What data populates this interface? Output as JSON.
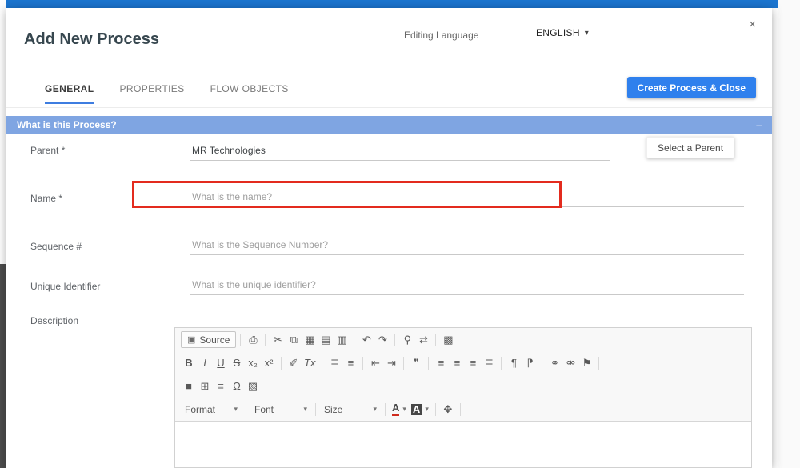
{
  "colors": {
    "accent_blue": "#2f80ed",
    "app_bar_blue": "#1b75d0",
    "section_bar_blue": "#7fa5e2",
    "highlight_red": "#e32b1e"
  },
  "icons": {
    "caret": "▾"
  },
  "modal": {
    "title": "Add New Process",
    "editing_language_label": "Editing Language",
    "language_value": "ENGLISH",
    "close_icon": "×",
    "tabs": [
      {
        "label": "GENERAL"
      },
      {
        "label": "PROPERTIES"
      },
      {
        "label": "FLOW OBJECTS"
      }
    ],
    "create_button_label": "Create Process & Close",
    "section": {
      "title": "What is this Process?",
      "collapse_icon": "–"
    },
    "fields": {
      "parent": {
        "label": "Parent *",
        "value": "MR Technologies",
        "button_label": "Select a Parent"
      },
      "name": {
        "label": "Name *",
        "placeholder": "What is the name?"
      },
      "sequence": {
        "label": "Sequence #",
        "placeholder": "What is the Sequence Number?"
      },
      "unique": {
        "label": "Unique Identifier",
        "placeholder": "What is the unique identifier?"
      },
      "description": {
        "label": "Description"
      }
    },
    "editor": {
      "toolbar1": [
        {
          "name": "source-button",
          "icon": "▣",
          "label": "Source"
        },
        {
          "sep": true
        },
        {
          "name": "print-icon",
          "glyph": "⎙"
        },
        {
          "sep": true
        },
        {
          "name": "cut-icon",
          "glyph": "✂"
        },
        {
          "name": "copy-icon",
          "glyph": "⧉"
        },
        {
          "name": "paste-icon",
          "glyph": "▦"
        },
        {
          "name": "paste-text-icon",
          "glyph": "▤"
        },
        {
          "name": "paste-word-icon",
          "glyph": "▥"
        },
        {
          "sep": true
        },
        {
          "name": "undo-icon",
          "glyph": "↶"
        },
        {
          "name": "redo-icon",
          "glyph": "↷"
        },
        {
          "sep": true
        },
        {
          "name": "find-icon",
          "glyph": "⚲"
        },
        {
          "name": "replace-icon",
          "glyph": "⇄"
        },
        {
          "sep": true
        },
        {
          "name": "select-all-icon",
          "glyph": "▩"
        }
      ],
      "toolbar2": [
        {
          "name": "bold-icon",
          "glyph": "B",
          "cls": "g-bold"
        },
        {
          "name": "italic-icon",
          "glyph": "I",
          "cls": "g-italic"
        },
        {
          "name": "underline-icon",
          "glyph": "U",
          "cls": "g-under"
        },
        {
          "name": "strike-icon",
          "glyph": "S",
          "cls": "g-strike"
        },
        {
          "name": "subscript-icon",
          "glyph": "x₂"
        },
        {
          "name": "superscript-icon",
          "glyph": "x²"
        },
        {
          "sep": true
        },
        {
          "name": "copy-formatting-icon",
          "glyph": "✐"
        },
        {
          "name": "remove-format-icon",
          "glyph": "Tx",
          "cls": "g-italic"
        },
        {
          "sep": true
        },
        {
          "name": "numbered-list-icon",
          "glyph": "≣"
        },
        {
          "name": "bulleted-list-icon",
          "glyph": "≡"
        },
        {
          "sep": true
        },
        {
          "name": "outdent-icon",
          "glyph": "⇤"
        },
        {
          "name": "indent-icon",
          "glyph": "⇥"
        },
        {
          "sep": true
        },
        {
          "name": "blockquote-icon",
          "glyph": "❞"
        },
        {
          "sep": true
        },
        {
          "name": "align-left-icon",
          "glyph": "≡"
        },
        {
          "name": "align-center-icon",
          "glyph": "≡"
        },
        {
          "name": "align-right-icon",
          "glyph": "≡"
        },
        {
          "name": "align-justify-icon",
          "glyph": "≣"
        },
        {
          "sep": true
        },
        {
          "name": "text-direction-ltr-icon",
          "glyph": "¶"
        },
        {
          "name": "text-direction-rtl-icon",
          "glyph": "⁋"
        },
        {
          "sep": true
        },
        {
          "name": "link-icon",
          "glyph": "⚭"
        },
        {
          "name": "unlink-icon",
          "glyph": "⚮"
        },
        {
          "name": "anchor-icon",
          "glyph": "⚑"
        },
        {
          "sep": true
        }
      ],
      "toolbar3": [
        {
          "name": "embed-icon",
          "glyph": "■"
        },
        {
          "name": "table-icon",
          "glyph": "⊞"
        },
        {
          "name": "horizontal-rule-icon",
          "glyph": "≡"
        },
        {
          "name": "special-character-icon",
          "glyph": "Ω"
        },
        {
          "name": "image-icon",
          "glyph": "▧"
        }
      ],
      "toolbar4": [
        {
          "name": "format-select",
          "label": "Format",
          "type": "dropdown"
        },
        {
          "sep": true
        },
        {
          "name": "font-select",
          "label": "Font",
          "type": "dropdown"
        },
        {
          "sep": true
        },
        {
          "name": "size-select",
          "label": "Size",
          "type": "dropdown"
        },
        {
          "sep": true
        },
        {
          "name": "text-color-button",
          "glyph": "A",
          "cls": "txtcolor",
          "type": "color"
        },
        {
          "name": "background-color-button",
          "glyph": "A",
          "cls": "bgcolor",
          "type": "color"
        },
        {
          "sep": true
        },
        {
          "name": "maximize-icon",
          "glyph": "✥"
        },
        {
          "sep": true
        }
      ]
    }
  }
}
